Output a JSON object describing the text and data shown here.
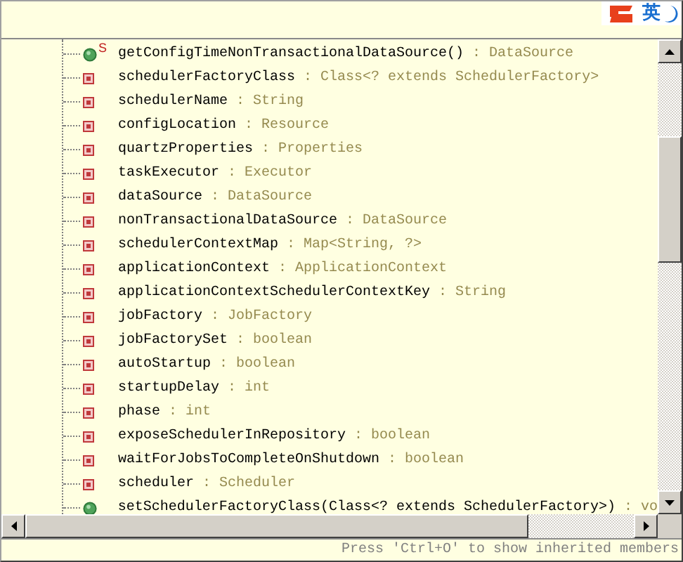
{
  "ime_toolbar": {
    "language": "英"
  },
  "members": [
    {
      "kind": "method",
      "static_marker": "S",
      "name": "getConfigTimeNonTransactionalDataSource()",
      "type": ": DataSource"
    },
    {
      "kind": "field",
      "name": "schedulerFactoryClass",
      "type": ": Class<? extends SchedulerFactory>"
    },
    {
      "kind": "field",
      "name": "schedulerName",
      "type": ": String"
    },
    {
      "kind": "field",
      "name": "configLocation",
      "type": ": Resource"
    },
    {
      "kind": "field",
      "name": "quartzProperties",
      "type": ": Properties"
    },
    {
      "kind": "field",
      "name": "taskExecutor",
      "type": ": Executor"
    },
    {
      "kind": "field",
      "name": "dataSource",
      "type": ": DataSource"
    },
    {
      "kind": "field",
      "name": "nonTransactionalDataSource",
      "type": ": DataSource"
    },
    {
      "kind": "field",
      "name": "schedulerContextMap",
      "type": ": Map<String, ?>"
    },
    {
      "kind": "field",
      "name": "applicationContext",
      "type": ": ApplicationContext"
    },
    {
      "kind": "field",
      "name": "applicationContextSchedulerContextKey",
      "type": ": String"
    },
    {
      "kind": "field",
      "name": "jobFactory",
      "type": ": JobFactory"
    },
    {
      "kind": "field",
      "name": "jobFactorySet",
      "type": ": boolean"
    },
    {
      "kind": "field",
      "name": "autoStartup",
      "type": ": boolean"
    },
    {
      "kind": "field",
      "name": "startupDelay",
      "type": ": int"
    },
    {
      "kind": "field",
      "name": "phase",
      "type": ": int"
    },
    {
      "kind": "field",
      "name": "exposeSchedulerInRepository",
      "type": ": boolean"
    },
    {
      "kind": "field",
      "name": "waitForJobsToCompleteOnShutdown",
      "type": ": boolean"
    },
    {
      "kind": "field",
      "name": "scheduler",
      "type": ": Scheduler"
    },
    {
      "kind": "method",
      "name": "setSchedulerFactoryClass(Class<? extends SchedulerFactory>)",
      "type": ": vo"
    }
  ],
  "status_bar": "Press 'Ctrl+O' to show inherited members"
}
